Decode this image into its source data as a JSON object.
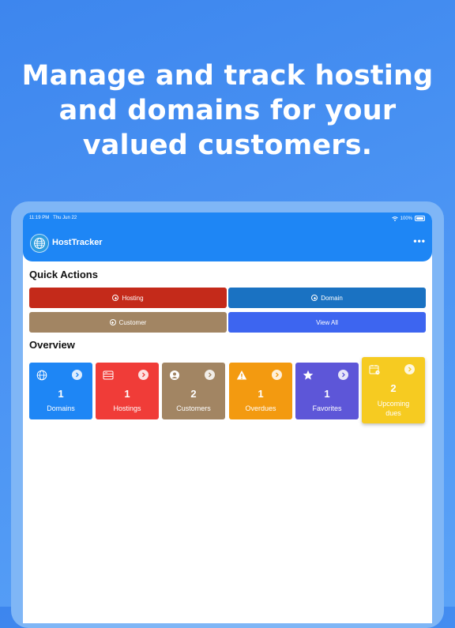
{
  "headline": {
    "line1": "Manage and track hosting",
    "line2": "and domains for your",
    "line3": "valued customers."
  },
  "status_bar": {
    "time": "11:19 PM",
    "date": "Thu Jun 22",
    "battery": "100%"
  },
  "app": {
    "title": "HostTracker",
    "more_icon": "ellipsis-icon",
    "logo_icon": "globe-icon"
  },
  "quick_actions": {
    "title": "Quick Actions",
    "buttons": [
      {
        "label": "Hosting",
        "color": "#c42a1a",
        "icon": "plus-circle-icon"
      },
      {
        "label": "Domain",
        "color": "#1a72c2",
        "icon": "plus-circle-icon"
      },
      {
        "label": "Customer",
        "color": "#a28563",
        "icon": "plus-circle-icon"
      },
      {
        "label": "View All",
        "color": "#3d65f0"
      }
    ]
  },
  "overview": {
    "title": "Overview",
    "cards": [
      {
        "count": "1",
        "label": "Domains",
        "color": "#1e86f5",
        "icon": "globe-icon"
      },
      {
        "count": "1",
        "label": "Hostings",
        "color": "#f03c38",
        "icon": "server-icon"
      },
      {
        "count": "2",
        "label": "Customers",
        "color": "#a28563",
        "icon": "person-icon"
      },
      {
        "count": "1",
        "label": "Overdues",
        "color": "#f39a10",
        "icon": "warning-icon"
      },
      {
        "count": "1",
        "label": "Favorites",
        "color": "#5d56d8",
        "icon": "star-icon"
      },
      {
        "count": "2",
        "label": "Upcoming dues",
        "color": "#f6cb21",
        "icon": "calendar-icon"
      }
    ]
  }
}
